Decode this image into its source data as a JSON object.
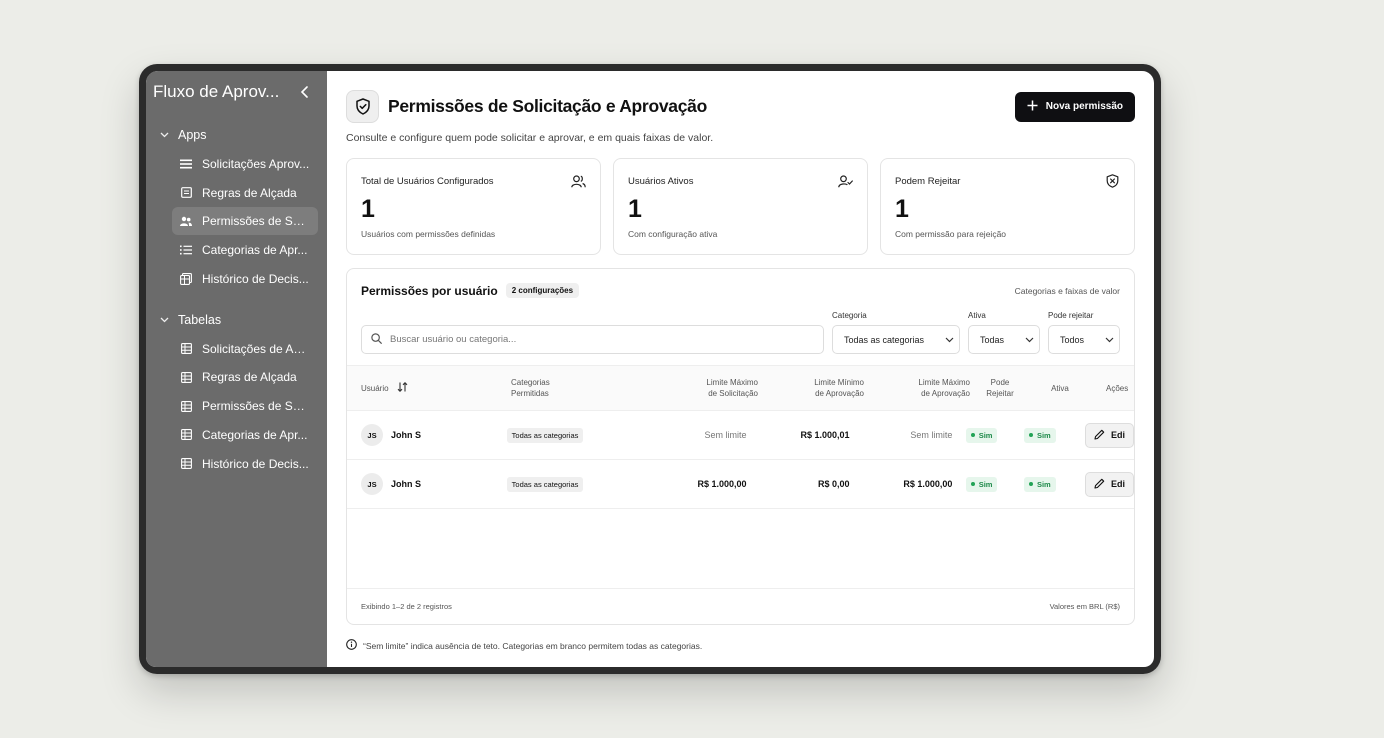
{
  "sidebar": {
    "title": "Fluxo de Aprov...",
    "groups": [
      {
        "label": "Apps",
        "items": [
          {
            "label": "Solicitações Aprov...",
            "icon": "list-icon"
          },
          {
            "label": "Regras de Alçada",
            "icon": "document-icon"
          },
          {
            "label": "Permissões de Sol...",
            "icon": "users-icon",
            "active": true
          },
          {
            "label": "Categorias de Apr...",
            "icon": "list-ordered-icon"
          },
          {
            "label": "Histórico de Decis...",
            "icon": "history-table-icon"
          }
        ]
      },
      {
        "label": "Tabelas",
        "items": [
          {
            "label": "Solicitações de Ap...",
            "icon": "table-icon"
          },
          {
            "label": "Regras de Alçada",
            "icon": "table-icon"
          },
          {
            "label": "Permissões de Sol...",
            "icon": "table-icon"
          },
          {
            "label": "Categorias de Apr...",
            "icon": "table-icon"
          },
          {
            "label": "Histórico de Decis...",
            "icon": "table-icon"
          }
        ]
      }
    ]
  },
  "header": {
    "title": "Permissões de Solicitação e Aprovação",
    "subtitle": "Consulte e configure quem pode solicitar e aprovar, e em quais faixas de valor.",
    "new_button": "Nova permissão"
  },
  "stats": [
    {
      "label": "Total de Usuários Configurados",
      "value": "1",
      "desc": "Usuários com permissões definidas",
      "icon": "users-icon"
    },
    {
      "label": "Usuários Ativos",
      "value": "1",
      "desc": "Com configuração ativa",
      "icon": "user-check-icon"
    },
    {
      "label": "Podem Rejeitar",
      "value": "1",
      "desc": "Com permissão para rejeição",
      "icon": "shield-x-icon"
    }
  ],
  "panel": {
    "title": "Permissões por usuário",
    "badge": "2 configurações",
    "link": "Categorias e faixas de valor",
    "search_placeholder": "Buscar usuário ou categoria...",
    "filters": {
      "categoria_label": "Categoria",
      "categoria_value": "Todas as categorias",
      "ativa_label": "Ativa",
      "ativa_value": "Todas",
      "rejeitar_label": "Pode rejeitar",
      "rejeitar_value": "Todos"
    },
    "columns": {
      "usuario": "Usuário",
      "categorias_1": "Categorias",
      "categorias_2": "Permitidas",
      "lms_1": "Limite Máximo",
      "lms_2": "de Solicitação",
      "lmin_1": "Limite Mínimo",
      "lmin_2": "de Aprovação",
      "lmax_1": "Limite Máximo",
      "lmax_2": "de Aprovação",
      "rej_1": "Pode",
      "rej_2": "Rejeitar",
      "ativa": "Ativa",
      "acoes": "Ações"
    },
    "rows": [
      {
        "initials": "JS",
        "name": "John S",
        "categoria": "Todas as categorias",
        "lim_sol": "Sem limite",
        "lim_min": "R$ 1.000,01",
        "lim_max": "Sem limite",
        "rejeitar": "Sim",
        "ativa": "Sim",
        "action": "Edi"
      },
      {
        "initials": "JS",
        "name": "John S",
        "categoria": "Todas as categorias",
        "lim_sol": "R$ 1.000,00",
        "lim_min": "R$ 0,00",
        "lim_max": "R$ 1.000,00",
        "rejeitar": "Sim",
        "ativa": "Sim",
        "action": "Edi"
      }
    ],
    "footer_left": "Exibindo 1–2 de 2 registros",
    "footer_right": "Valores em BRL (R$)"
  },
  "note": "“Sem limite” indica ausência de teto. Categorias em branco permitem todas as categorias.",
  "colors": {
    "accent": "#0f0f12",
    "sidebar": "#6b6b6b",
    "success": "#1e8a4a"
  }
}
